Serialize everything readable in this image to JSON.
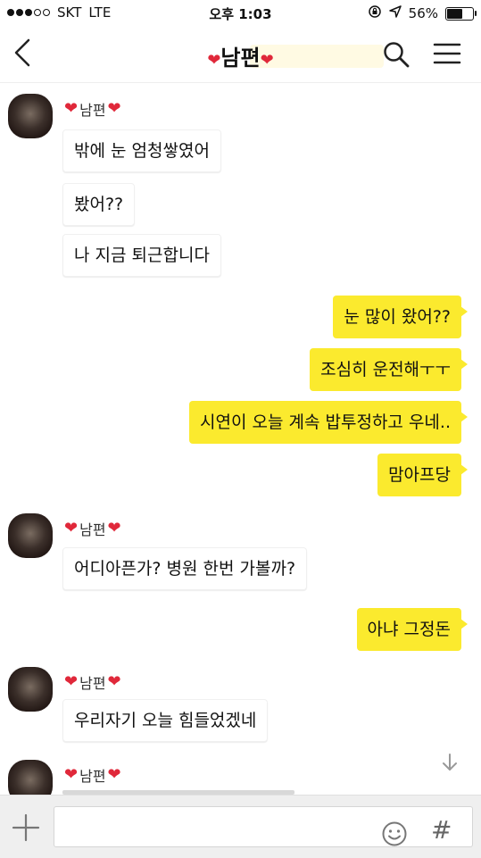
{
  "status": {
    "carrier": "SKT",
    "network": "LTE",
    "time": "오후 1:03",
    "battery": "56%",
    "signal_bars_filled": 3,
    "signal_bars_total": 5
  },
  "header": {
    "title": "남편",
    "title_decor": "❤",
    "back_icon": "chevron-left-icon",
    "search_icon": "search-icon",
    "menu_icon": "hamburger-menu-icon"
  },
  "messages": [
    {
      "from": "other",
      "sender": "남편",
      "text": "밖에 눈 엄청쌓였어"
    },
    {
      "from": "other",
      "text": "봤어??"
    },
    {
      "from": "other",
      "text": "나 지금 퇴근합니다"
    },
    {
      "from": "me",
      "text": "눈 많이 왔어??"
    },
    {
      "from": "me",
      "text": "조심히 운전해ㅜㅜ"
    },
    {
      "from": "me",
      "text": "시연이 오늘 계속 밥투정하고 우네.."
    },
    {
      "from": "me",
      "text": "맘아프당"
    },
    {
      "from": "other",
      "sender": "남편",
      "text": "어디아픈가? 병원 한번 가볼까?"
    },
    {
      "from": "me",
      "text": "아냐 그정돈"
    },
    {
      "from": "other",
      "sender": "남편",
      "text": "우리자기 오늘 힘들었겠네"
    },
    {
      "from": "other",
      "sender": "남편",
      "text": ""
    }
  ],
  "labels": {
    "sender_1": "남편",
    "sender_2": "남편",
    "sender_3": "남편",
    "sender_4": "남편"
  },
  "input": {
    "placeholder": "",
    "plus_icon": "plus-icon",
    "emoji_icon": "emoji-icon",
    "hash_label": "#"
  },
  "colors": {
    "my_bubble": "#fbea2e",
    "their_bubble": "#ffffff",
    "heart": "#e0283a"
  }
}
